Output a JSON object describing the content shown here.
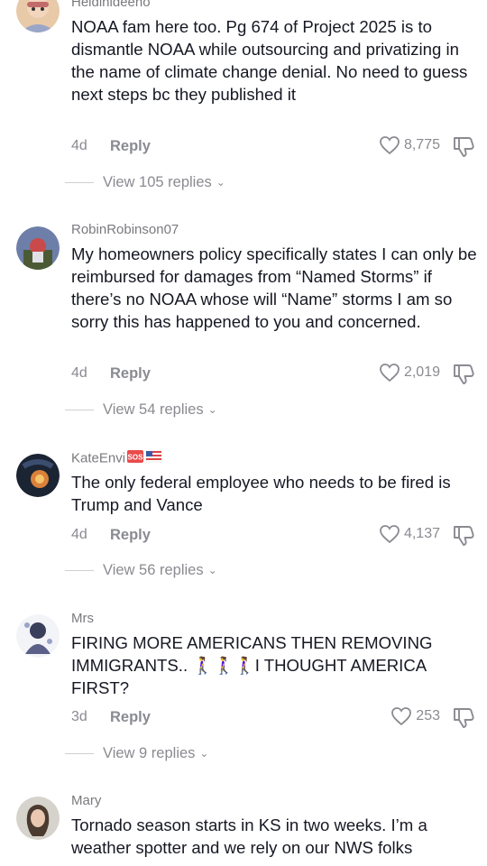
{
  "comments": [
    {
      "username": "Heidihideeho",
      "text": "NOAA fam here too. Pg 674 of Project 2025 is to dismantle NOAA while outsourcing and privatizing in the name of climate change denial. No need to guess next steps bc they published it",
      "age": "4d",
      "reply_label": "Reply",
      "likes": "8,775",
      "view_replies": "View 105 replies"
    },
    {
      "username": "RobinRobinson07",
      "text": "My homeowners policy specifically states I can only be reimbursed for damages from “Named Storms” if there’s no NOAA whose will “Name” storms I am so sorry this has happened to you and concerned.",
      "age": "4d",
      "reply_label": "Reply",
      "likes": "2,019",
      "view_replies": "View 54 replies"
    },
    {
      "username": "KateEnvi",
      "badge": "SOS",
      "text": "The only federal employee who needs to be fired is Trump and Vance",
      "age": "4d",
      "reply_label": "Reply",
      "likes": "4,137",
      "view_replies": "View 56 replies"
    },
    {
      "username": "Mrs",
      "text": "FIRING MORE AMERICANS THEN REMOVING IMMIGRANTS.. 🚶‍♀️🚶‍♀️🚶‍♀️I THOUGHT AMERICA FIRST?",
      "age": "3d",
      "reply_label": "Reply",
      "likes": "253",
      "view_replies": "View 9 replies"
    },
    {
      "username": "Mary",
      "text": "Tornado season starts in KS in two weeks. I’m a weather spotter and we rely on our NWS folks"
    }
  ],
  "colors": {
    "text": "#161823",
    "muted": "#8a8b91",
    "background": "#ffffff"
  },
  "icons": {
    "like": "heart-outline-icon",
    "dislike": "thumbs-down-icon",
    "expand": "chevron-down-icon"
  }
}
